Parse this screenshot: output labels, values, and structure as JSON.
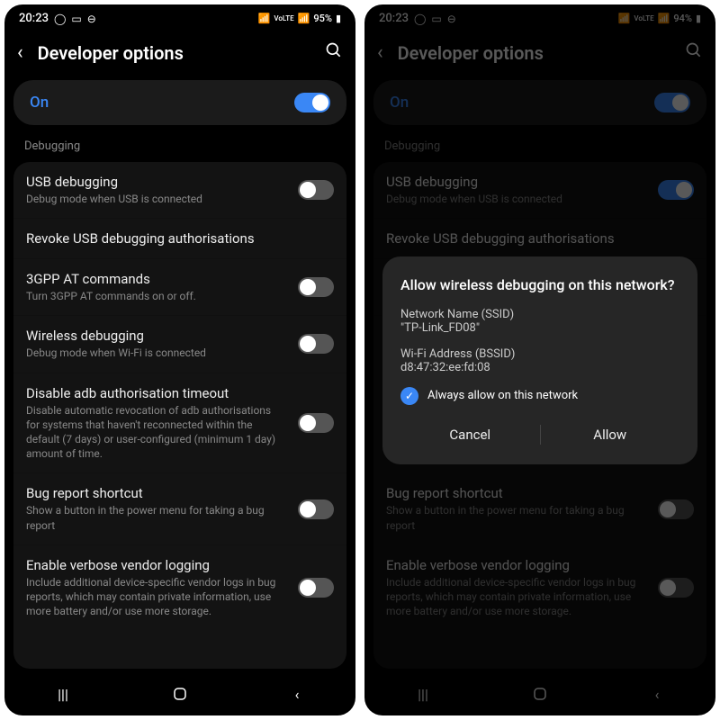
{
  "status": {
    "time": "20:23",
    "battery": "95%",
    "battery2": "94%",
    "signal": "VoLTE"
  },
  "header": {
    "title": "Developer options"
  },
  "main_toggle": {
    "label": "On"
  },
  "section": "Debugging",
  "rows": [
    {
      "title": "USB debugging",
      "sub": "Debug mode when USB is connected",
      "toggle": "off"
    },
    {
      "title": "Revoke USB debugging authorisations",
      "sub": ""
    },
    {
      "title": "3GPP AT commands",
      "sub": "Turn 3GPP AT commands on or off.",
      "toggle": "off"
    },
    {
      "title": "Wireless debugging",
      "sub": "Debug mode when Wi-Fi is connected",
      "toggle": "off"
    },
    {
      "title": "Disable adb authorisation timeout",
      "sub": "Disable automatic revocation of adb authorisations for systems that haven't reconnected within the default (7 days) or user-configured (minimum 1 day) amount of time.",
      "toggle": "off"
    },
    {
      "title": "Bug report shortcut",
      "sub": "Show a button in the power menu for taking a bug report",
      "toggle": "off"
    },
    {
      "title": "Enable verbose vendor logging",
      "sub": "Include additional device-specific vendor logs in bug reports, which may contain private information, use more battery and/or use more storage.",
      "toggle": "off"
    }
  ],
  "rows2_usb_toggle": "on",
  "dialog": {
    "title": "Allow wireless debugging on this network?",
    "ssid_label": "Network Name (SSID)",
    "ssid_val": "\"TP-Link_FD08\"",
    "bssid_label": "Wi-Fi Address (BSSID)",
    "bssid_val": "d8:47:32:ee:fd:08",
    "always": "Always allow on this network",
    "cancel": "Cancel",
    "allow": "Allow"
  }
}
